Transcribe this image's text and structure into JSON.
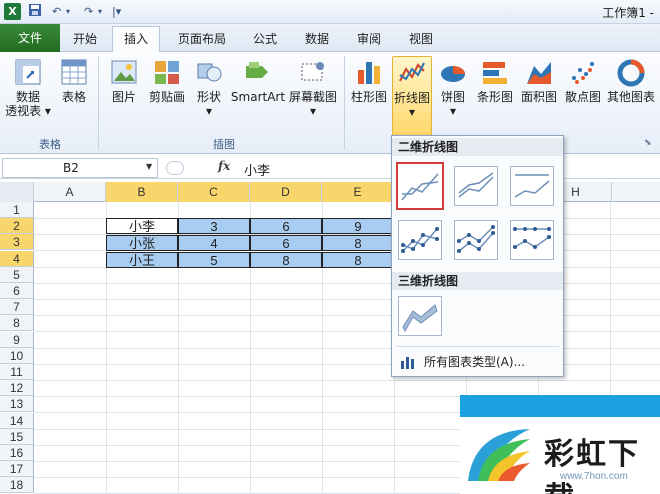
{
  "titlebar": {
    "app_logo": "X",
    "undo": "↶",
    "redo": "↷",
    "customize": "|▾",
    "doc_title": "工作簿1 -"
  },
  "tabs": [
    "文件",
    "开始",
    "插入",
    "页面布局",
    "公式",
    "数据",
    "审阅",
    "视图"
  ],
  "active_tab": "插入",
  "ribbon": {
    "buttons": [
      {
        "label": "数据",
        "label2": "透视表 ▾",
        "icon": "pivottable-icon"
      },
      {
        "label": "表格",
        "icon": "table-icon"
      },
      {
        "label": "图片",
        "icon": "picture-icon"
      },
      {
        "label": "剪贴画",
        "icon": "clipart-icon"
      },
      {
        "label": "形状",
        "label2": "▾",
        "icon": "shapes-icon"
      },
      {
        "label": "SmartArt",
        "icon": "smartart-icon"
      },
      {
        "label": "屏幕截图",
        "label2": "▾",
        "icon": "screenshot-icon"
      },
      {
        "label": "柱形图",
        "icon": "column-chart-icon"
      },
      {
        "label": "折线图",
        "label2": "▾",
        "icon": "line-chart-icon"
      },
      {
        "label": "饼图",
        "label2": "▾",
        "icon": "pie-chart-icon"
      },
      {
        "label": "条形图",
        "icon": "bar-chart-icon"
      },
      {
        "label": "面积图",
        "icon": "area-chart-icon"
      },
      {
        "label": "散点图",
        "icon": "scatter-chart-icon"
      },
      {
        "label": "其他图表",
        "icon": "other-chart-icon"
      }
    ],
    "groups": [
      "表格",
      "插图"
    ]
  },
  "formula": {
    "namebox": "B2",
    "fx": "fx",
    "content": "小李"
  },
  "columns": [
    "A",
    "B",
    "C",
    "D",
    "E",
    "H"
  ],
  "rows": [
    "1",
    "2",
    "3",
    "4",
    "5",
    "6",
    "7",
    "8",
    "9",
    "10",
    "11",
    "12",
    "13",
    "14",
    "15",
    "16",
    "17",
    "18"
  ],
  "cells": {
    "r2": [
      "小李",
      "3",
      "6",
      "9"
    ],
    "r3": [
      "小张",
      "4",
      "6",
      "8"
    ],
    "r4": [
      "小王",
      "5",
      "8",
      "8"
    ]
  },
  "dropdown": {
    "section_2d": "二维折线图",
    "section_3d": "三维折线图",
    "all_types": "所有图表类型(A)..."
  },
  "watermark": {
    "text": "彩虹下载",
    "url": "www.7hon.com"
  }
}
